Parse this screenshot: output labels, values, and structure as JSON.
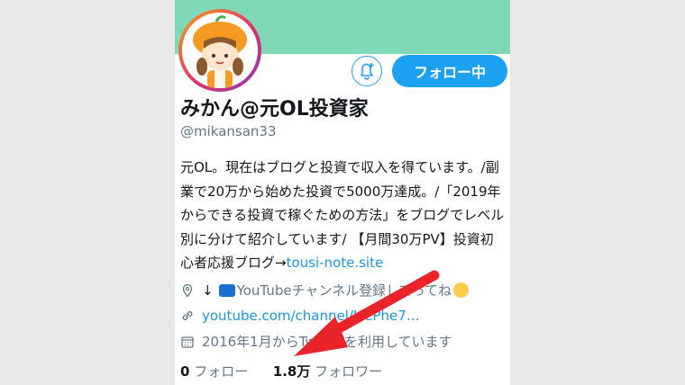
{
  "profile": {
    "follow_button_label": "フォロー中",
    "name": "みかん@元OL投資家",
    "handle": "@mikansan33",
    "bio_text": "元OL。現在はブログと投資で収入を得ています。/副業で20万から始めた投資で5000万達成。/「2019年からできる投資で稼ぐための方法」をブログでレベル別に分けて紹介しています/ 【月間30万PV】投資初心者応援ブログ→",
    "bio_link": "tousi-note.site",
    "location_prefix": "↓",
    "location_text": "YouTubeチャンネル登録してってね",
    "url": "youtube.com/channel/UCPhe7…",
    "joined": "2016年1月からTwitterを利用しています",
    "following_count": "0",
    "following_label": "フォロー",
    "followers_count": "1.8万",
    "followers_label": "フォロワー"
  },
  "icons": [
    "avatar",
    "bell-plus-icon",
    "location-pin-icon",
    "tv-icon",
    "smile-emoji-icon",
    "link-icon",
    "calendar-icon",
    "red-arrow"
  ],
  "colors": {
    "banner": "#7fd8b6",
    "accent": "#1da1f2",
    "link": "#1b95e0",
    "secondary_text": "#657786",
    "annotation_arrow": "#e8232a"
  }
}
